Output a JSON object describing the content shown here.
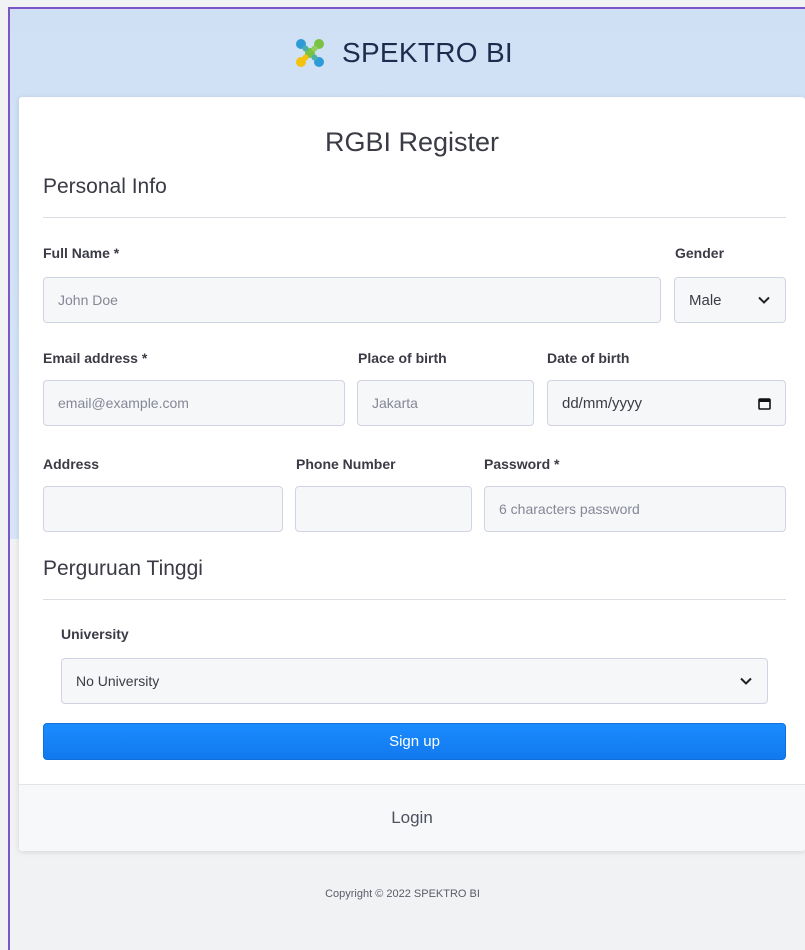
{
  "brand": {
    "name": "SPEKTRO BI",
    "logo_icon": "spektro-cross-logo-icon"
  },
  "form": {
    "title": "RGBI Register",
    "personal_section": "Personal Info",
    "full_name": {
      "label": "Full Name *",
      "placeholder": "John Doe",
      "value": ""
    },
    "gender": {
      "label": "Gender",
      "selected": "Male"
    },
    "email": {
      "label": "Email address *",
      "placeholder": "email@example.com",
      "value": ""
    },
    "place_of_birth": {
      "label": "Place of birth",
      "placeholder": "Jakarta",
      "value": ""
    },
    "date_of_birth": {
      "label": "Date of birth",
      "placeholder": "dd/mm/yyyy"
    },
    "address": {
      "label": "Address",
      "value": ""
    },
    "phone": {
      "label": "Phone Number",
      "value": ""
    },
    "password": {
      "label": "Password *",
      "placeholder": "6 characters password"
    },
    "university_section": "Perguruan Tinggi",
    "university": {
      "label": "University",
      "selected": "No University"
    },
    "submit_label": "Sign up",
    "login_label": "Login"
  },
  "footer": {
    "copyright": "Copyright © 2022 SPEKTRO BI"
  },
  "colors": {
    "primary": "#1a8cff",
    "header_bg": "#cfe0f5",
    "frame_border": "#7c55c9"
  }
}
